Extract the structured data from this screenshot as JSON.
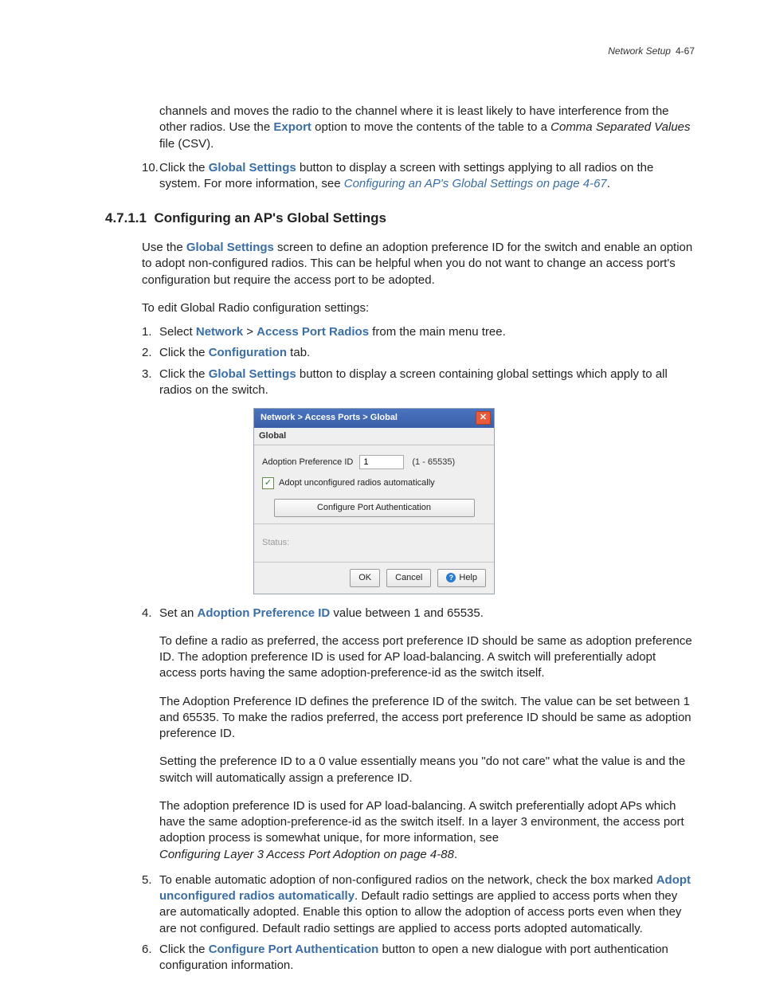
{
  "header": {
    "section": "Network Setup",
    "page": "4-67"
  },
  "intro_continued": {
    "p1a": "channels and moves the radio to the channel where it is least likely to have interference from the other radios. Use the ",
    "export": "Export",
    "p1b": " option to move the contents of the table to a ",
    "csv_ital": "Comma Separated Values",
    "p1c": " file (CSV)."
  },
  "step10": {
    "num": "10.",
    "a": "Click the ",
    "gs": "Global Settings",
    "b": " button to display a screen with settings applying to all radios on the system. For more information, see ",
    "link": "Configuring an AP's Global Settings on page 4-67",
    "c": "."
  },
  "heading": {
    "num": "4.7.1.1",
    "title": "Configuring an AP's Global Settings"
  },
  "body": {
    "p1a": "Use the ",
    "gs": "Global Settings",
    "p1b": " screen to define an adoption preference ID for the switch and enable an option to adopt non-configured radios. This can be helpful when you do not want to change an access port's configuration but require the access port to be adopted.",
    "p2": "To edit Global Radio configuration settings:"
  },
  "steps": {
    "s1": {
      "n": "1.",
      "a": "Select ",
      "network": "Network",
      "gt": " > ",
      "apr": "Access Port Radios",
      "b": " from the main menu tree."
    },
    "s2": {
      "n": "2.",
      "a": "Click the ",
      "cfg": "Configuration",
      "b": " tab."
    },
    "s3": {
      "n": "3.",
      "a": "Click the ",
      "gs": "Global Settings",
      "b": " button to display a screen containing global settings which apply to all radios on the switch."
    },
    "s4": {
      "n": "4.",
      "a": "Set an ",
      "apid": "Adoption Preference ID",
      "b": " value between 1 and 65535.",
      "p1": "To define a radio as preferred, the access port preference ID should be same as adoption preference ID. The adoption preference ID is used for AP load-balancing. A switch will preferentially adopt access ports having the same adoption-preference-id as the switch itself.",
      "p2": "The Adoption Preference ID defines the preference ID of the switch. The value can be set between 1 and 65535. To make the radios preferred, the access port preference ID should be same as adoption preference ID.",
      "p3": "Setting the preference ID to a 0 value essentially means you \"do not care\" what the value is and the switch will automatically assign a preference ID.",
      "p4": "The adoption preference ID is used for AP load-balancing. A switch preferentially adopt APs which have the same adoption-preference-id as the switch itself. In a layer 3 environment, the access port adoption process is somewhat unique, for more information, see",
      "p4_ital": "Configuring Layer 3 Access Port Adoption on page 4-88",
      "p4_end": "."
    },
    "s5": {
      "n": "5.",
      "a": "To enable automatic adoption of non-configured radios on the network, check the box marked ",
      "adopt": "Adopt unconfigured radios automatically",
      "b": ". Default radio settings are applied to access ports when they are automatically adopted. Enable this option to allow the adoption of access ports even when they are not configured. Default radio settings are applied to access ports adopted automatically."
    },
    "s6": {
      "n": "6.",
      "a": "Click the ",
      "cpa": "Configure Port Authentication",
      "b": " button to open a new dialogue with port authentication configuration information."
    }
  },
  "dialog": {
    "breadcrumb": "Network > Access Ports > Global",
    "tab": "Global",
    "pref_label": "Adoption Preference ID",
    "pref_value": "1",
    "range": "(1 - 65535)",
    "check_label": "Adopt unconfigured radios automatically",
    "checked": true,
    "big_btn": "Configure Port Authentication",
    "status_label": "Status:",
    "ok": "OK",
    "cancel": "Cancel",
    "help": "Help"
  }
}
